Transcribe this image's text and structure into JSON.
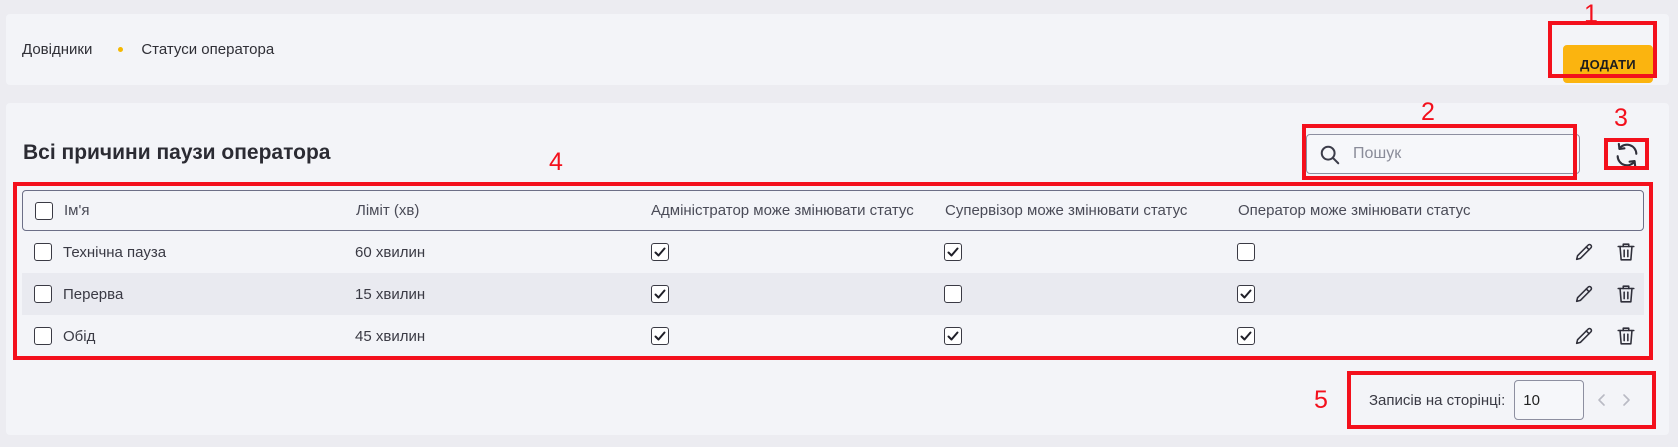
{
  "breadcrumb": {
    "root": "Довідники",
    "current": "Статуси оператора",
    "dot_color": "#f5b800"
  },
  "actions": {
    "add_label": "ДОДАТИ",
    "add_color": "#fbb40f"
  },
  "panel": {
    "title": "Всі причини паузи оператора"
  },
  "search": {
    "placeholder": "Пошук",
    "value": ""
  },
  "table": {
    "columns": {
      "name": "Ім'я",
      "limit": "Ліміт (хв)",
      "admin": "Адміністратор може змінювати статус",
      "supervisor": "Супервізор може змінювати статус",
      "operator": "Оператор може змінювати статус"
    },
    "rows": [
      {
        "name": "Технічна пауза",
        "limit": "60 хвилин",
        "admin": true,
        "supervisor": true,
        "operator": false
      },
      {
        "name": "Перерва",
        "limit": "15 хвилин",
        "admin": true,
        "supervisor": false,
        "operator": true
      },
      {
        "name": "Обід",
        "limit": "45 хвилин",
        "admin": true,
        "supervisor": true,
        "operator": true
      }
    ]
  },
  "pagination": {
    "label": "Записів на сторінці:",
    "page_size": "10"
  },
  "annotations": {
    "color": "#f3101c",
    "labels": [
      "1",
      "2",
      "3",
      "4",
      "5"
    ]
  },
  "icons": {
    "search": "search-icon",
    "refresh": "refresh-icon",
    "edit": "pencil-icon",
    "delete": "trash-icon",
    "prev": "chevron-left-icon",
    "next": "chevron-right-icon"
  }
}
